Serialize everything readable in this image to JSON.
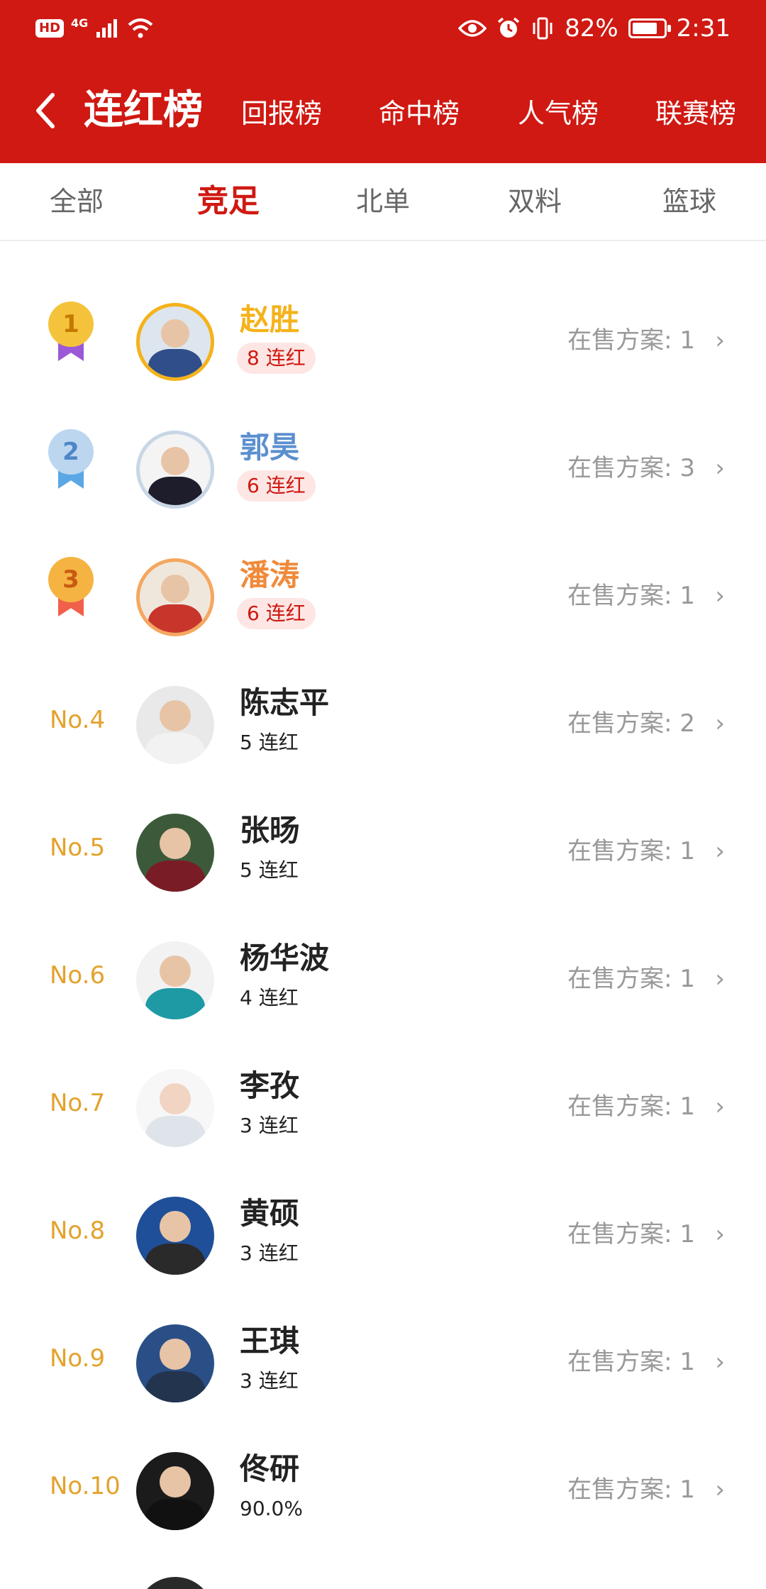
{
  "status": {
    "hd": "HD",
    "network": "4G",
    "battery": "82%",
    "battery_level": 0.82,
    "time": "2:31",
    "icons": [
      "signal-icon",
      "wifi-icon",
      "eye-icon",
      "alarm-icon",
      "vibrate-icon",
      "battery-icon"
    ]
  },
  "header": {
    "title": "连红榜",
    "tabs": [
      "回报榜",
      "命中榜",
      "人气榜",
      "联赛榜"
    ]
  },
  "sub_tabs": {
    "items": [
      "全部",
      "竞足",
      "北单",
      "双料",
      "篮球"
    ],
    "active": "竞足"
  },
  "colors": {
    "brand": "#cf1912",
    "gold": "#f5b21b",
    "silver_name": "#5b8fcf",
    "bronze_name": "#f08a3a",
    "rank_text": "#e3a22c"
  },
  "rows": [
    {
      "rank": "1",
      "name": "赵胜",
      "streak": "8 连红",
      "sale_label": "在售方案:",
      "sale_count": "1"
    },
    {
      "rank": "2",
      "name": "郭昊",
      "streak": "6 连红",
      "sale_label": "在售方案:",
      "sale_count": "3"
    },
    {
      "rank": "3",
      "name": "潘涛",
      "streak": "6 连红",
      "sale_label": "在售方案:",
      "sale_count": "1"
    },
    {
      "rank": "No.4",
      "name": "陈志平",
      "streak": "5 连红",
      "sale_label": "在售方案:",
      "sale_count": "2"
    },
    {
      "rank": "No.5",
      "name": "张旸",
      "streak": "5 连红",
      "sale_label": "在售方案:",
      "sale_count": "1"
    },
    {
      "rank": "No.6",
      "name": "杨华波",
      "streak": "4 连红",
      "sale_label": "在售方案:",
      "sale_count": "1"
    },
    {
      "rank": "No.7",
      "name": "李孜",
      "streak": "3 连红",
      "sale_label": "在售方案:",
      "sale_count": "1"
    },
    {
      "rank": "No.8",
      "name": "黄硕",
      "streak": "3 连红",
      "sale_label": "在售方案:",
      "sale_count": "1"
    },
    {
      "rank": "No.9",
      "name": "王琪",
      "streak": "3 连红",
      "sale_label": "在售方案:",
      "sale_count": "1"
    },
    {
      "rank": "No.10",
      "name": "佟研",
      "streak": "90.0%",
      "sale_label": "在售方案:",
      "sale_count": "1"
    }
  ]
}
